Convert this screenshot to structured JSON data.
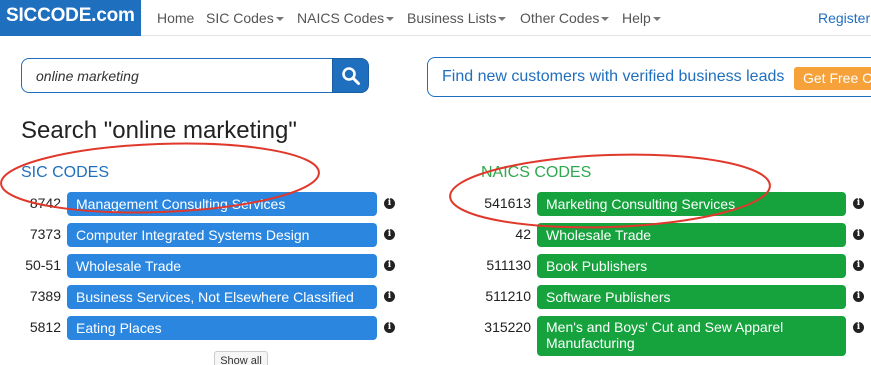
{
  "nav": {
    "logo": "SICCODE.com",
    "home": "Home",
    "sic_codes": "SIC Codes",
    "naics_codes": "NAICS Codes",
    "business_lists": "Business Lists",
    "other_codes": "Other Codes",
    "help": "Help",
    "register": "Register"
  },
  "search": {
    "value": "online marketing"
  },
  "promo": {
    "text": "Find new customers with verified business leads",
    "button": "Get Free C"
  },
  "page_title": "Search \"online marketing\"",
  "sic": {
    "heading": "SIC CODES",
    "rows": [
      {
        "code": "8742",
        "label": "Management Consulting Services"
      },
      {
        "code": "7373",
        "label": "Computer Integrated Systems Design"
      },
      {
        "code": "50-51",
        "label": "Wholesale Trade"
      },
      {
        "code": "7389",
        "label": "Business Services, Not Elsewhere Classified"
      },
      {
        "code": "5812",
        "label": "Eating Places"
      }
    ],
    "show_all": "Show all"
  },
  "naics": {
    "heading": "NAICS CODES",
    "rows": [
      {
        "code": "541613",
        "label": "Marketing Consulting Services"
      },
      {
        "code": "42",
        "label": "Wholesale Trade"
      },
      {
        "code": "511130",
        "label": "Book Publishers"
      },
      {
        "code": "511210",
        "label": "Software Publishers"
      },
      {
        "code": "315220",
        "label": "Men's and Boys' Cut and Sew Apparel",
        "label2": "Manufacturing"
      }
    ]
  },
  "info_glyph": "i",
  "colors": {
    "brand_blue": "#1f6fbf",
    "sic_pill": "#2b86e0",
    "naics_pill": "#16a33d",
    "naics_heading": "#2fa84f",
    "promo_button": "#f6a13a",
    "annotation_red": "#e0382b"
  }
}
